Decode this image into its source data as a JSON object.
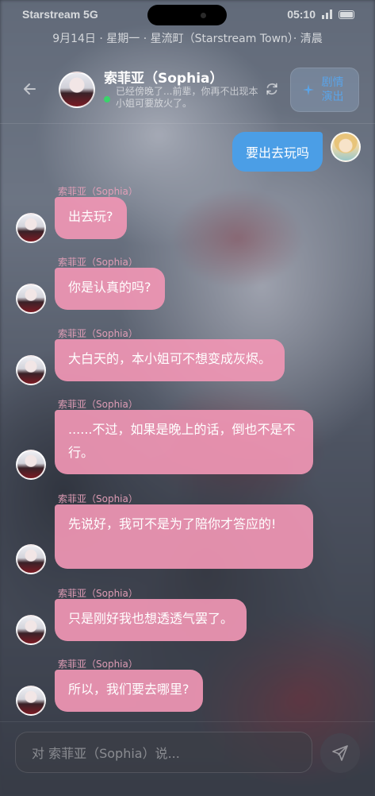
{
  "status_bar": {
    "carrier": "Starstream 5G",
    "time": "05:10"
  },
  "scene": {
    "line": "9月14日 · 星期一 · 星流町（Starstream Town）· 清晨"
  },
  "header": {
    "name": "索菲亚（Sophia）",
    "status_text": "已经傍晚了...前辈，你再不出现本小姐可要放火了。",
    "drama_button": "剧情演出",
    "drama_icon": "sparkle-icon"
  },
  "messages": {
    "user": {
      "text": "要出去玩吗"
    },
    "ai_name": "索菲亚（Sophia）",
    "ai": [
      {
        "name": "索菲亚（Sophia）",
        "text": "出去玩?"
      },
      {
        "name": "索菲亚（Sophia）",
        "text": "你是认真的吗?"
      },
      {
        "name": "索菲亚（Sophia）",
        "text": "大白天的，本小姐可不想变成灰烬。"
      },
      {
        "name": "索菲亚（Sophia）",
        "text": "......不过，如果是晚上的话，倒也不是不行。"
      },
      {
        "name": "索菲亚（Sophia）",
        "text": "先说好，我可不是为了陪你才答应的!"
      },
      {
        "name": "索菲亚（Sophia）",
        "text": "只是刚好我也想透透气罢了。"
      },
      {
        "name": "索菲亚（Sophia）",
        "text": "所以，我们要去哪里?"
      }
    ]
  },
  "input": {
    "placeholder": "对 索菲亚（Sophia）说..."
  },
  "colors": {
    "user_bubble": "#4b9ee6",
    "ai_bubble": "#f096b4",
    "online": "#3ad46b",
    "accent": "#5aa4e8"
  }
}
